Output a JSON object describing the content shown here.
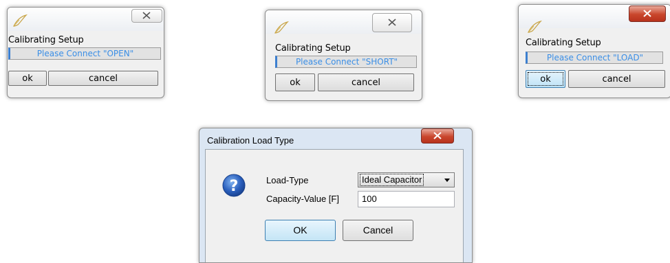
{
  "dialog_open": {
    "title": "Calibrating Setup",
    "status": "Please Connect \"OPEN\"",
    "ok_label": "ok",
    "cancel_label": "cancel"
  },
  "dialog_short": {
    "title": "Calibrating Setup",
    "status": "Please Connect \"SHORT\"",
    "ok_label": "ok",
    "cancel_label": "cancel"
  },
  "dialog_load": {
    "title": "Calibrating Setup",
    "status": "Please Connect \"LOAD\"",
    "ok_label": "ok",
    "cancel_label": "cancel"
  },
  "load_type_dialog": {
    "title": "Calibration Load Type",
    "load_type_label": "Load-Type",
    "load_type_value": "Ideal Capacitor",
    "capacity_label": "Capacity-Value [F]",
    "capacity_value": "100",
    "ok_label": "OK",
    "cancel_label": "Cancel"
  },
  "icons": {
    "app": "feather-pen-icon",
    "close": "close-icon",
    "question": "question-icon",
    "dropdown": "chevron-down-icon"
  },
  "colors": {
    "status_text": "#3a8ee6",
    "close_red": "#c9462c",
    "question_blue": "#1f4fa5"
  }
}
